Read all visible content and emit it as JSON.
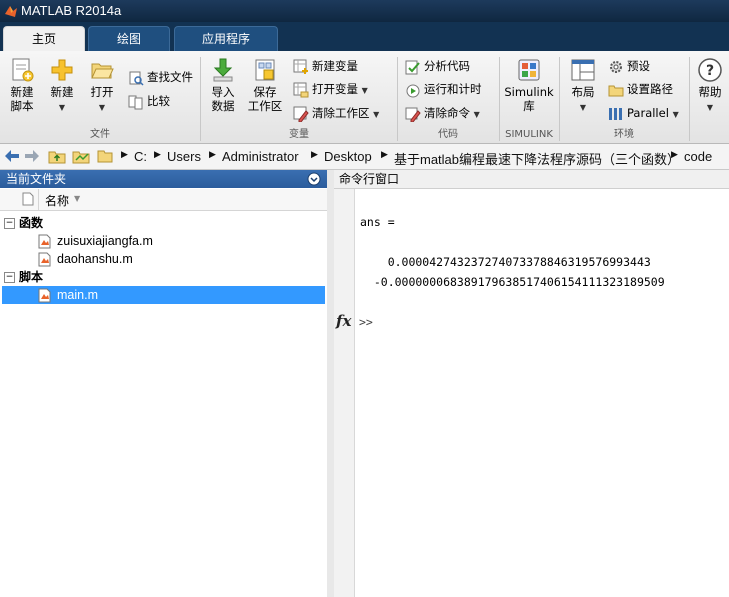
{
  "window": {
    "title": "MATLAB R2014a"
  },
  "tabs": [
    {
      "label": "主页",
      "active": true
    },
    {
      "label": "绘图",
      "active": false
    },
    {
      "label": "应用程序",
      "active": false
    }
  ],
  "ribbon": {
    "new_script": "新建\n脚本",
    "new": "新建",
    "open": "打开",
    "find_files": "查找文件",
    "compare": "比较",
    "file_group": "文件",
    "import_data": "导入\n数据",
    "save_workspace": "保存\n工作区",
    "new_variable": "新建变量",
    "open_variable": "打开变量",
    "clear_workspace": "清除工作区",
    "variable_group": "变量",
    "analyze_code": "分析代码",
    "run_and_time": "运行和计时",
    "clear_commands": "清除命令",
    "code_group": "代码",
    "simulink_library": "Simulink\n库",
    "simulink_group": "SIMULINK",
    "layout": "布局",
    "preferences": "预设",
    "set_path": "设置路径",
    "parallel": "Parallel",
    "environment_group": "环境",
    "help": "帮助"
  },
  "address": {
    "crumbs": [
      "C:",
      "Users",
      "Administrator",
      "Desktop",
      "基于matlab编程最速下降法程序源码（三个函数）",
      "code"
    ]
  },
  "current_folder": {
    "title": "当前文件夹",
    "column_name": "名称",
    "groups": [
      {
        "label": "函数",
        "files": [
          "zuisuxiajiangfa.m",
          "daohanshu.m"
        ]
      },
      {
        "label": "脚本",
        "files": [
          "main.m"
        ]
      }
    ],
    "selected_file": "main.m"
  },
  "command_window": {
    "title": "命令行窗口",
    "lines": [
      "ans =",
      "",
      "    0.000042743237274073378846319576993443",
      "  -0.000000068389179638517406154111323189509"
    ],
    "prompt": ">>",
    "fx_label": "fx"
  },
  "colors": {
    "accent": "#3399ff",
    "titlebar": "#1d3a5c",
    "tabstrip": "#123252"
  }
}
